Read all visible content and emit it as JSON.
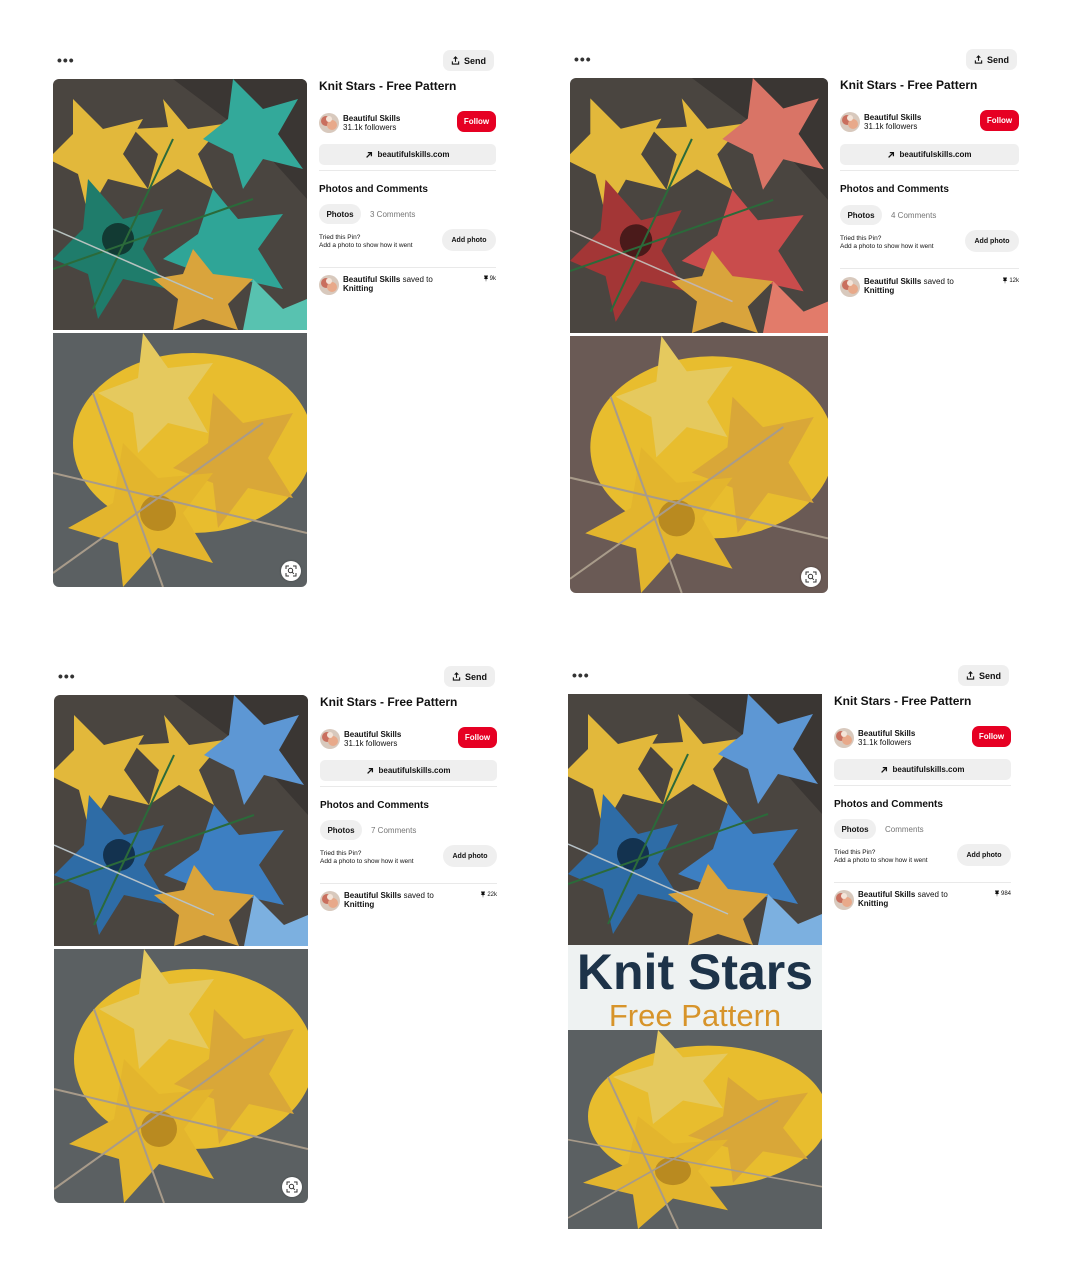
{
  "common": {
    "more_label": "•••",
    "send_label": "Send",
    "title": "Knit Stars - Free Pattern",
    "author_name": "Beautiful Skills",
    "author_followers": "31.1k followers",
    "follow_label": "Follow",
    "site_label": "beautifulskills.com",
    "section_title": "Photos and Comments",
    "photos_tab": "Photos",
    "tried_line1": "Tried this Pin?",
    "tried_line2": "Add a photo to show how it went",
    "add_photo_label": "Add photo",
    "saved_author": "Beautiful Skills",
    "saved_to_text": "saved to",
    "board_name": "Knitting"
  },
  "pins": [
    {
      "comments_label": "3 Comments",
      "saves_count": "9k",
      "accent_color": "#2fa597"
    },
    {
      "comments_label": "4 Comments",
      "saves_count": "12k",
      "accent_color": "#c94c4c"
    },
    {
      "comments_label": "7 Comments",
      "saves_count": "22k",
      "accent_color": "#3d7fc2"
    },
    {
      "comments_label": "Comments",
      "saves_count": "984",
      "accent_color": "#3d7fc2",
      "banner_title": "Knit Stars",
      "banner_subtitle": "Free Pattern"
    }
  ],
  "icons": [
    "more-icon",
    "share-icon",
    "arrow-up-right-icon",
    "visual-search-icon",
    "pin-icon"
  ],
  "colors": {
    "follow": "#e60023",
    "button_bg": "#efefef",
    "banner_title": "#1d3349",
    "banner_sub": "#d7942a"
  }
}
